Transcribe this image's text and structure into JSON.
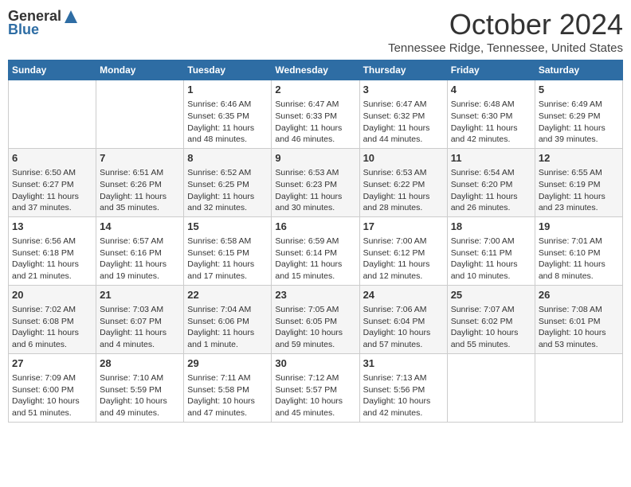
{
  "header": {
    "logo_general": "General",
    "logo_blue": "Blue",
    "month_title": "October 2024",
    "location": "Tennessee Ridge, Tennessee, United States"
  },
  "days_of_week": [
    "Sunday",
    "Monday",
    "Tuesday",
    "Wednesday",
    "Thursday",
    "Friday",
    "Saturday"
  ],
  "weeks": [
    [
      {
        "day": "",
        "detail": ""
      },
      {
        "day": "",
        "detail": ""
      },
      {
        "day": "1",
        "detail": "Sunrise: 6:46 AM\nSunset: 6:35 PM\nDaylight: 11 hours and 48 minutes."
      },
      {
        "day": "2",
        "detail": "Sunrise: 6:47 AM\nSunset: 6:33 PM\nDaylight: 11 hours and 46 minutes."
      },
      {
        "day": "3",
        "detail": "Sunrise: 6:47 AM\nSunset: 6:32 PM\nDaylight: 11 hours and 44 minutes."
      },
      {
        "day": "4",
        "detail": "Sunrise: 6:48 AM\nSunset: 6:30 PM\nDaylight: 11 hours and 42 minutes."
      },
      {
        "day": "5",
        "detail": "Sunrise: 6:49 AM\nSunset: 6:29 PM\nDaylight: 11 hours and 39 minutes."
      }
    ],
    [
      {
        "day": "6",
        "detail": "Sunrise: 6:50 AM\nSunset: 6:27 PM\nDaylight: 11 hours and 37 minutes."
      },
      {
        "day": "7",
        "detail": "Sunrise: 6:51 AM\nSunset: 6:26 PM\nDaylight: 11 hours and 35 minutes."
      },
      {
        "day": "8",
        "detail": "Sunrise: 6:52 AM\nSunset: 6:25 PM\nDaylight: 11 hours and 32 minutes."
      },
      {
        "day": "9",
        "detail": "Sunrise: 6:53 AM\nSunset: 6:23 PM\nDaylight: 11 hours and 30 minutes."
      },
      {
        "day": "10",
        "detail": "Sunrise: 6:53 AM\nSunset: 6:22 PM\nDaylight: 11 hours and 28 minutes."
      },
      {
        "day": "11",
        "detail": "Sunrise: 6:54 AM\nSunset: 6:20 PM\nDaylight: 11 hours and 26 minutes."
      },
      {
        "day": "12",
        "detail": "Sunrise: 6:55 AM\nSunset: 6:19 PM\nDaylight: 11 hours and 23 minutes."
      }
    ],
    [
      {
        "day": "13",
        "detail": "Sunrise: 6:56 AM\nSunset: 6:18 PM\nDaylight: 11 hours and 21 minutes."
      },
      {
        "day": "14",
        "detail": "Sunrise: 6:57 AM\nSunset: 6:16 PM\nDaylight: 11 hours and 19 minutes."
      },
      {
        "day": "15",
        "detail": "Sunrise: 6:58 AM\nSunset: 6:15 PM\nDaylight: 11 hours and 17 minutes."
      },
      {
        "day": "16",
        "detail": "Sunrise: 6:59 AM\nSunset: 6:14 PM\nDaylight: 11 hours and 15 minutes."
      },
      {
        "day": "17",
        "detail": "Sunrise: 7:00 AM\nSunset: 6:12 PM\nDaylight: 11 hours and 12 minutes."
      },
      {
        "day": "18",
        "detail": "Sunrise: 7:00 AM\nSunset: 6:11 PM\nDaylight: 11 hours and 10 minutes."
      },
      {
        "day": "19",
        "detail": "Sunrise: 7:01 AM\nSunset: 6:10 PM\nDaylight: 11 hours and 8 minutes."
      }
    ],
    [
      {
        "day": "20",
        "detail": "Sunrise: 7:02 AM\nSunset: 6:08 PM\nDaylight: 11 hours and 6 minutes."
      },
      {
        "day": "21",
        "detail": "Sunrise: 7:03 AM\nSunset: 6:07 PM\nDaylight: 11 hours and 4 minutes."
      },
      {
        "day": "22",
        "detail": "Sunrise: 7:04 AM\nSunset: 6:06 PM\nDaylight: 11 hours and 1 minute."
      },
      {
        "day": "23",
        "detail": "Sunrise: 7:05 AM\nSunset: 6:05 PM\nDaylight: 10 hours and 59 minutes."
      },
      {
        "day": "24",
        "detail": "Sunrise: 7:06 AM\nSunset: 6:04 PM\nDaylight: 10 hours and 57 minutes."
      },
      {
        "day": "25",
        "detail": "Sunrise: 7:07 AM\nSunset: 6:02 PM\nDaylight: 10 hours and 55 minutes."
      },
      {
        "day": "26",
        "detail": "Sunrise: 7:08 AM\nSunset: 6:01 PM\nDaylight: 10 hours and 53 minutes."
      }
    ],
    [
      {
        "day": "27",
        "detail": "Sunrise: 7:09 AM\nSunset: 6:00 PM\nDaylight: 10 hours and 51 minutes."
      },
      {
        "day": "28",
        "detail": "Sunrise: 7:10 AM\nSunset: 5:59 PM\nDaylight: 10 hours and 49 minutes."
      },
      {
        "day": "29",
        "detail": "Sunrise: 7:11 AM\nSunset: 5:58 PM\nDaylight: 10 hours and 47 minutes."
      },
      {
        "day": "30",
        "detail": "Sunrise: 7:12 AM\nSunset: 5:57 PM\nDaylight: 10 hours and 45 minutes."
      },
      {
        "day": "31",
        "detail": "Sunrise: 7:13 AM\nSunset: 5:56 PM\nDaylight: 10 hours and 42 minutes."
      },
      {
        "day": "",
        "detail": ""
      },
      {
        "day": "",
        "detail": ""
      }
    ]
  ]
}
